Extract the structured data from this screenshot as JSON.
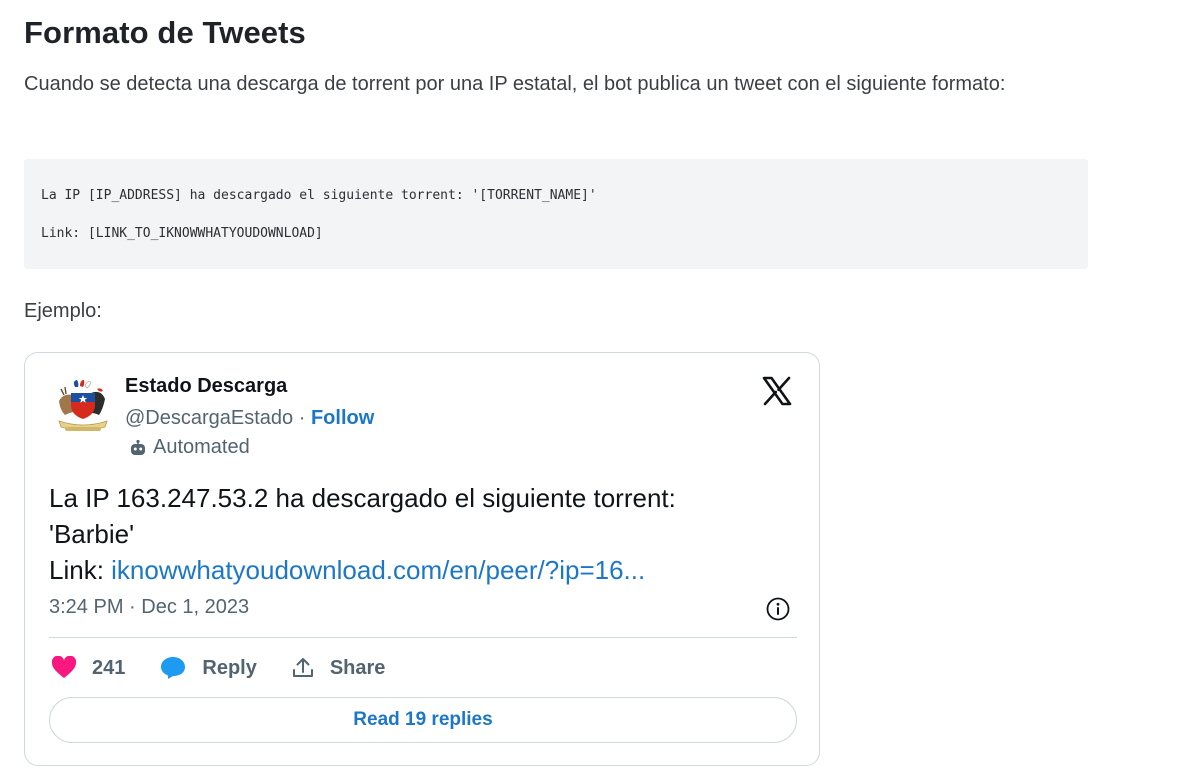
{
  "section": {
    "title": "Formato de Tweets",
    "description": "Cuando se detecta una descarga de torrent por una IP estatal, el bot publica un tweet con el siguiente formato:",
    "code_lines": [
      "La IP [IP_ADDRESS] ha descargado el siguiente torrent: '[TORRENT_NAME]'",
      "Link: [LINK_TO_IKNOWWHATYOUDOWNLOAD]"
    ],
    "example_label": "Ejemplo:"
  },
  "tweet": {
    "display_name": "Estado Descarga",
    "handle": "@DescargaEstado",
    "separator": " · ",
    "follow_label": "Follow",
    "automated_label": "Automated",
    "text_line1": "La IP 163.247.53.2 ha descargado el siguiente torrent:",
    "text_line2": "'Barbie'",
    "link_prefix": "Link: ",
    "link_text": "iknowwhatyoudownload.com/en/peer/?ip=16...",
    "timestamp": "3:24 PM · Dec 1, 2023",
    "like_count": "241",
    "reply_label": "Reply",
    "share_label": "Share",
    "read_replies_label": "Read 19 replies"
  },
  "colors": {
    "link": "#1d77c9",
    "like": "#f91880",
    "reply_icon": "#1d9bf0",
    "muted": "#536471",
    "code_bg": "#f3f4f6"
  },
  "icons": {
    "avatar": "chile-coat-of-arms-icon",
    "platform": "x-logo-icon",
    "automated": "bot-icon",
    "info": "info-icon",
    "like": "heart-icon",
    "reply": "speech-bubble-icon",
    "share": "share-icon"
  }
}
